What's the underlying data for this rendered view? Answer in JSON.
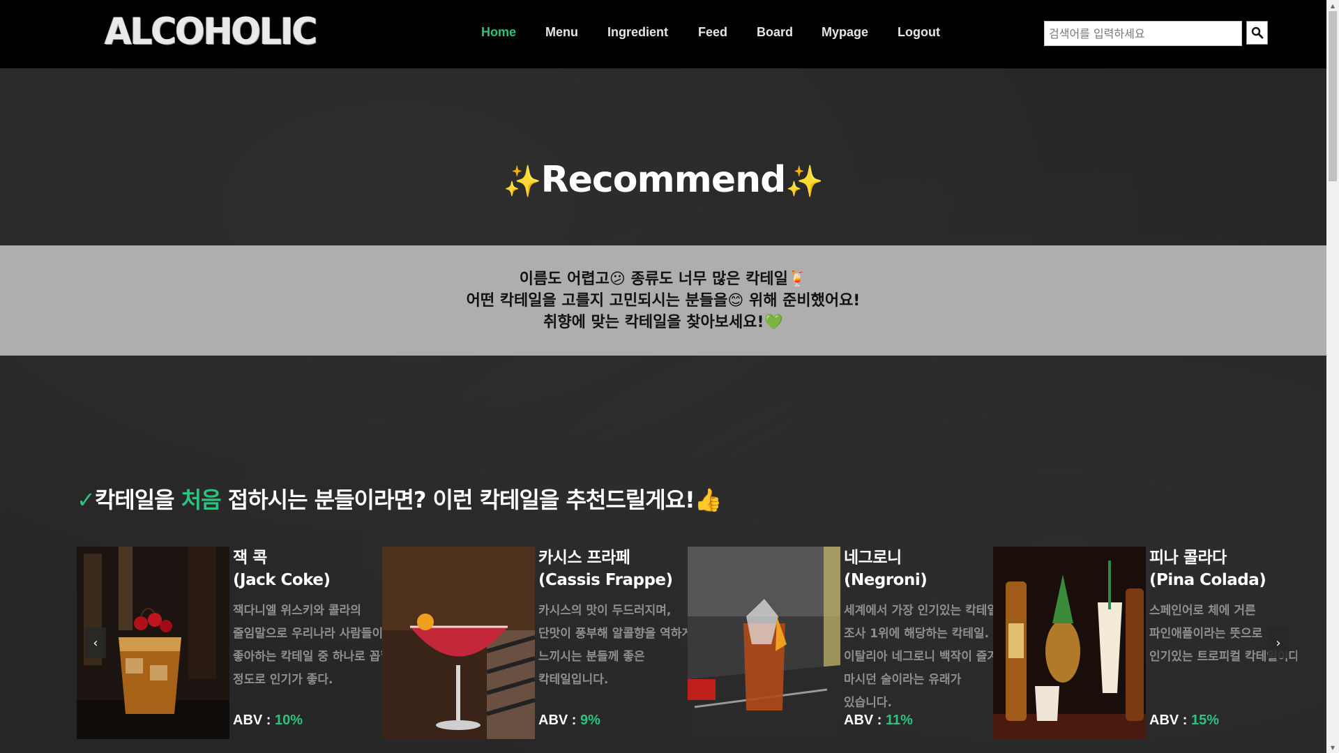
{
  "header": {
    "logo": "ALCOHOLIC",
    "nav": [
      {
        "label": "Home",
        "active": true
      },
      {
        "label": "Menu",
        "active": false
      },
      {
        "label": "Ingredient",
        "active": false
      },
      {
        "label": "Feed",
        "active": false
      },
      {
        "label": "Board",
        "active": false
      },
      {
        "label": "Mypage",
        "active": false
      },
      {
        "label": "Logout",
        "active": false
      }
    ],
    "search": {
      "placeholder": "검색어를 입력하세요",
      "icon": "search-icon"
    }
  },
  "hero": {
    "title": "Recommend",
    "spark": "✨"
  },
  "intro": {
    "lines": [
      "이름도 어렵고😕 종류도 너무 많은 칵테일🍹",
      "어떤 칵테일을 고를지 고민되시는 분들을😊 위해 준비했어요!",
      "취향에 맞는 칵테일을 찾아보세요!💚"
    ]
  },
  "section": {
    "check": "✓",
    "prefix": "칵테일을 ",
    "highlight": "처음",
    "suffix": " 접하시는 분들이라면? 이런 칵테일을 추천드릴게요!👍"
  },
  "cards": [
    {
      "kname": "잭 콕",
      "ename": "(Jack Coke)",
      "desc": "잭다니엘 위스키와 콜라의 줄임말으로 우리나라 사람들이 좋아하는 칵테일 중 하나로 꼽힐 정도로 인기가 좋다.",
      "abv_label": "ABV : ",
      "abv": "10%"
    },
    {
      "kname": "카시스 프라페",
      "ename": "(Cassis Frappe)",
      "desc": "카시스의 맛이 두드러지며, 단맛이 풍부해 알콜향을 역하게 느끼시는 분들께 좋은 칵테일입니다.",
      "abv_label": "ABV : ",
      "abv": "9%"
    },
    {
      "kname": "네그로니",
      "ename": "(Negroni)",
      "desc": "세계에서 가장 인기있는 칵테일 조사 1위에 해당하는 칵테일. 이탈리아 네그로니 백작이 즐겨 마시던 술이라는 유래가 있습니다.",
      "abv_label": "ABV : ",
      "abv": "11%"
    },
    {
      "kname": "피나 콜라다",
      "ename": "(Pina Colada)",
      "desc": "스페인어로 체에 거른 파인애플이라는 뜻으로 인기있는 트로피컬 칵테일이다.",
      "abv_label": "ABV : ",
      "abv": "15%"
    }
  ],
  "carousel": {
    "prev": "‹",
    "next": "›"
  },
  "colors": {
    "accent": "#2ec27e",
    "header_bg": "#000000",
    "board_bg": "#262626",
    "intro_bg": "#aeaeae"
  }
}
